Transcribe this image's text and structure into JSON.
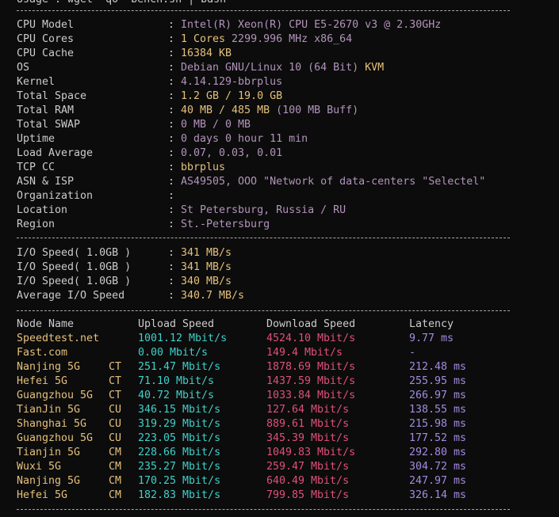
{
  "header_line": "Usage : wget -qO- bench.sh | bash",
  "system_info": [
    {
      "label": "CPU Model",
      "value": "Intel(R) Xeon(R) CPU E5-2670 v3 @ 2.30GHz",
      "color": "purple"
    },
    {
      "label": "CPU Cores",
      "value": "1 Cores 2299.996 MHz x86_64",
      "color": "yellow",
      "highlight": "1 Cores",
      "rest": " 2299.996 MHz x86_64"
    },
    {
      "label": "CPU Cache",
      "value": "16384 KB",
      "color": "yellow"
    },
    {
      "label": "OS",
      "value": "Debian GNU/Linux 10 (64 Bit) KVM",
      "color": "purple",
      "highlight": "Debian GNU/Linux 10 (64 Bit)",
      "rest": " KVM"
    },
    {
      "label": "Kernel",
      "value": "4.14.129-bbrplus",
      "color": "purple"
    },
    {
      "label": "Total Space",
      "value": "1.2 GB / 19.0 GB",
      "color": "yellow"
    },
    {
      "label": "Total RAM",
      "value": "40 MB / 485 MB (100 MB Buff)",
      "color": "yellow",
      "highlight": "40 MB / 485 MB",
      "rest": " (100 MB Buff)"
    },
    {
      "label": "Total SWAP",
      "value": "0 MB / 0 MB",
      "color": "purple"
    },
    {
      "label": "Uptime",
      "value": "0 days 0 hour 11 min",
      "color": "purple"
    },
    {
      "label": "Load Average",
      "value": "0.07, 0.03, 0.01",
      "color": "purple"
    },
    {
      "label": "TCP CC",
      "value": "bbrplus",
      "color": "yellow"
    },
    {
      "label": "ASN & ISP",
      "value": "AS49505, OOO \"Network of data-centers \"Selectel\"",
      "color": "purple"
    },
    {
      "label": "Organization",
      "value": "",
      "color": "purple"
    },
    {
      "label": "Location",
      "value": "St Petersburg, Russia / RU",
      "color": "purple"
    },
    {
      "label": "Region",
      "value": "St.-Petersburg",
      "color": "purple"
    }
  ],
  "io": [
    {
      "label": "I/O Speed( 1.0GB )",
      "value": "341 MB/s"
    },
    {
      "label": "I/O Speed( 1.0GB )",
      "value": "341 MB/s"
    },
    {
      "label": "I/O Speed( 1.0GB )",
      "value": "340 MB/s"
    },
    {
      "label": "Average I/O Speed",
      "value": "340.7 MB/s"
    }
  ],
  "speed_headers": {
    "node": "Node Name",
    "upload": "Upload Speed",
    "download": "Download Speed",
    "latency": "Latency"
  },
  "speed_rows": [
    {
      "node": "Speedtest.net",
      "isp": "",
      "upload": "1001.12 Mbit/s",
      "download": "4524.10 Mbit/s",
      "latency": "9.77 ms"
    },
    {
      "node": "Fast.com",
      "isp": "",
      "upload": "0.00 Mbit/s",
      "download": "149.4 Mbit/s",
      "latency": "-"
    },
    {
      "node": "Nanjing 5G",
      "isp": "CT",
      "upload": "251.47 Mbit/s",
      "download": "1878.69 Mbit/s",
      "latency": "212.48 ms"
    },
    {
      "node": "Hefei 5G",
      "isp": "CT",
      "upload": "71.10 Mbit/s",
      "download": "1437.59 Mbit/s",
      "latency": "255.95 ms"
    },
    {
      "node": "Guangzhou 5G",
      "isp": "CT",
      "upload": "40.72 Mbit/s",
      "download": "1033.84 Mbit/s",
      "latency": "266.97 ms"
    },
    {
      "node": "TianJin 5G",
      "isp": "CU",
      "upload": "346.15 Mbit/s",
      "download": "127.64 Mbit/s",
      "latency": "138.55 ms"
    },
    {
      "node": "Shanghai 5G",
      "isp": "CU",
      "upload": "319.29 Mbit/s",
      "download": "889.61 Mbit/s",
      "latency": "215.98 ms"
    },
    {
      "node": "Guangzhou 5G",
      "isp": "CU",
      "upload": "223.05 Mbit/s",
      "download": "345.39 Mbit/s",
      "latency": "177.52 ms"
    },
    {
      "node": "Tianjin 5G",
      "isp": "CM",
      "upload": "228.66 Mbit/s",
      "download": "1049.83 Mbit/s",
      "latency": "292.80 ms"
    },
    {
      "node": "Wuxi 5G",
      "isp": "CM",
      "upload": "235.27 Mbit/s",
      "download": "259.47 Mbit/s",
      "latency": "304.72 ms"
    },
    {
      "node": "Nanjing 5G",
      "isp": "CM",
      "upload": "170.25 Mbit/s",
      "download": "640.49 Mbit/s",
      "latency": "247.97 ms"
    },
    {
      "node": "Hefei 5G",
      "isp": "CM",
      "upload": "182.83 Mbit/s",
      "download": "799.85 Mbit/s",
      "latency": "326.14 ms"
    }
  ],
  "colors": {
    "background": "#0c0c0c",
    "text": "#cccccc",
    "purple": "#b294bb",
    "yellow": "#e5c07b",
    "cyan": "#3fd0c9",
    "red": "#e05079",
    "latency": "#a48be0"
  }
}
